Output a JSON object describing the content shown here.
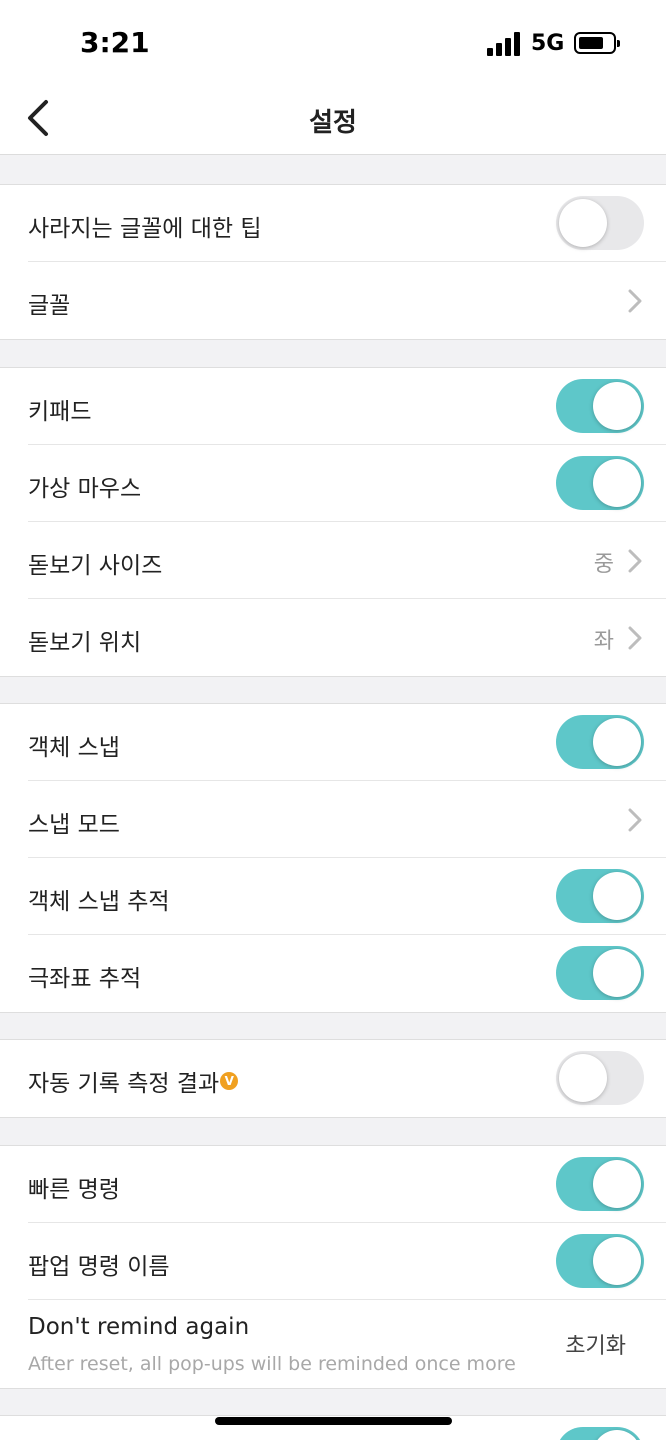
{
  "status_bar": {
    "time": "3:21",
    "network": "5G"
  },
  "nav": {
    "title": "설정"
  },
  "colors": {
    "toggle_on": "#5ec7c9",
    "toggle_off": "#e8e8ea",
    "badge": "#f0a020"
  },
  "groups": [
    {
      "rows": [
        {
          "label": "사라지는 글꼴에 대한 팁",
          "control": "toggle",
          "on": false
        },
        {
          "label": "글꼴",
          "control": "chevron"
        }
      ]
    },
    {
      "rows": [
        {
          "label": "키패드",
          "control": "toggle",
          "on": true
        },
        {
          "label": "가상 마우스",
          "control": "toggle",
          "on": true
        },
        {
          "label": "돋보기 사이즈",
          "control": "chevron",
          "value": "중"
        },
        {
          "label": "돋보기 위치",
          "control": "chevron",
          "value": "좌"
        }
      ]
    },
    {
      "rows": [
        {
          "label": "객체 스냅",
          "control": "toggle",
          "on": true
        },
        {
          "label": "스냅 모드",
          "control": "chevron"
        },
        {
          "label": "객체 스냅 추적",
          "control": "toggle",
          "on": true
        },
        {
          "label": "극좌표 추적",
          "control": "toggle",
          "on": true
        }
      ]
    },
    {
      "rows": [
        {
          "label": "자동 기록 측정 결과",
          "badge": "V",
          "control": "toggle",
          "on": false
        }
      ]
    },
    {
      "rows": [
        {
          "label": "빠른 명령",
          "control": "toggle",
          "on": true
        },
        {
          "label": "팝업 명령 이름",
          "control": "toggle",
          "on": true
        },
        {
          "label": "Don't remind again",
          "subtitle": "After reset, all pop-ups will be reminded once more",
          "control": "button",
          "button_label": "초기화"
        }
      ]
    },
    {
      "rows": [
        {
          "label": "",
          "control": "toggle",
          "on": true
        }
      ]
    }
  ]
}
